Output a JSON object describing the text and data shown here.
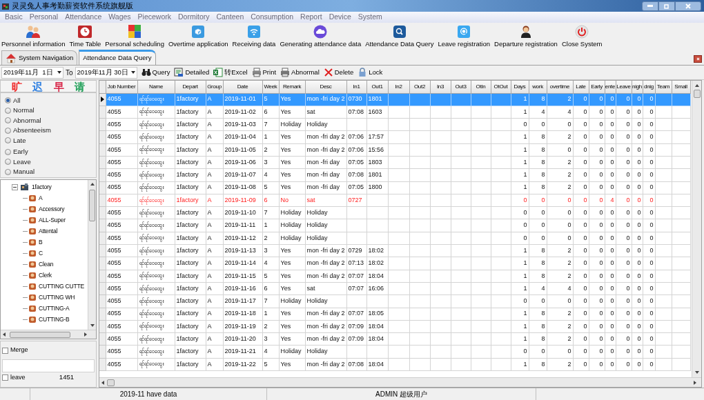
{
  "window": {
    "title": "灵灵兔人事考勤薪资软件系统旗舰版"
  },
  "menu": [
    "Basic",
    "Personal",
    "Attendance",
    "Wages",
    "Piecework",
    "Dormitory",
    "Canteen",
    "Consumption",
    "Report",
    "Device",
    "System"
  ],
  "toolbar": [
    {
      "label": "Personnel information"
    },
    {
      "label": "Time Table"
    },
    {
      "label": "Personal scheduling"
    },
    {
      "label": "Overtime application"
    },
    {
      "label": "Receiving data"
    },
    {
      "label": "Generating attendance data"
    },
    {
      "label": "Attendance Data Query"
    },
    {
      "label": "Leave registration"
    },
    {
      "label": "Departure registration"
    },
    {
      "label": "Close System"
    }
  ],
  "tabs": [
    {
      "label": "System Navigation",
      "selected": false
    },
    {
      "label": "Attendance Data Query",
      "selected": true
    }
  ],
  "query_bar": {
    "date_from": "2019年11月  1日",
    "to_label": "To",
    "date_to": "2019年11月 30日",
    "actions": [
      "Query",
      "Detailed",
      "转Excel",
      "Print",
      "Abnormal",
      "Delete",
      "Lock"
    ]
  },
  "legend": [
    {
      "label": "旷",
      "color": "#f02828"
    },
    {
      "label": "迟",
      "color": "#2a7de0"
    },
    {
      "label": "早",
      "color": "#d8284a"
    },
    {
      "label": "请",
      "color": "#20a058"
    }
  ],
  "filters": [
    {
      "label": "All",
      "selected": true
    },
    {
      "label": "Normal",
      "selected": false
    },
    {
      "label": "Abnormal",
      "selected": false
    },
    {
      "label": "Absenteeism",
      "selected": false
    },
    {
      "label": "Late",
      "selected": false
    },
    {
      "label": "Early",
      "selected": false
    },
    {
      "label": "Leave",
      "selected": false
    },
    {
      "label": "Manual",
      "selected": false
    }
  ],
  "tree": [
    {
      "label": "1factory",
      "expanded": true,
      "children": [
        {
          "label": "A"
        },
        {
          "label": "Accessory"
        },
        {
          "label": "ALL-Super"
        },
        {
          "label": "Attental"
        },
        {
          "label": "B"
        },
        {
          "label": "C"
        },
        {
          "label": "Clean"
        },
        {
          "label": "Clerk"
        },
        {
          "label": "CUTTING CUTTE"
        },
        {
          "label": "CUTTING WH"
        },
        {
          "label": "CUTTING-A"
        },
        {
          "label": "CUTTING-B"
        }
      ]
    }
  ],
  "merge": {
    "label": "Merge",
    "checked": false
  },
  "leave": {
    "label": "leave",
    "checked": false,
    "count": "1451"
  },
  "table": {
    "columns": [
      "Job Number",
      "Name",
      "Depart",
      "Group",
      "Date",
      "Week",
      "Remark",
      "Desc",
      "In1",
      "Out1",
      "In2",
      "Out2",
      "In3",
      "Out3",
      "OtIn",
      "OtOut",
      "Days",
      "work",
      "overtime",
      "Late",
      "Early",
      "ente",
      "Leave",
      "nigh",
      "dnig",
      "Team",
      "Small"
    ],
    "rows": [
      {
        "selected": true,
        "abnormal": false,
        "cells": [
          "4055",
          "ရင်ရင်ဝေထွေး",
          "1factory",
          "A",
          "2019-11-01",
          "5",
          "Yes",
          "mon -fri day 2",
          "0730",
          "1801",
          null,
          null,
          null,
          null,
          null,
          null,
          "1",
          "8",
          "2",
          "0",
          "0",
          "0",
          "0",
          "0",
          "0",
          null,
          null
        ]
      },
      {
        "selected": false,
        "abnormal": false,
        "cells": [
          "4055",
          "ရင်ရင်ဝေထွေး",
          "1factory",
          "A",
          "2019-11-02",
          "6",
          "Yes",
          "sat",
          "07:08",
          "1603",
          null,
          null,
          null,
          null,
          null,
          null,
          "1",
          "4",
          "4",
          "0",
          "0",
          "0",
          "0",
          "0",
          "0",
          null,
          null
        ]
      },
      {
        "selected": false,
        "abnormal": false,
        "cells": [
          "4055",
          "ရင်ရင်ဝေထွေး",
          "1factory",
          "A",
          "2019-11-03",
          "7",
          "Holiday",
          "Holiday",
          null,
          null,
          null,
          null,
          null,
          null,
          null,
          null,
          "0",
          "0",
          "0",
          "0",
          "0",
          "0",
          "0",
          "0",
          "0",
          null,
          null
        ]
      },
      {
        "selected": false,
        "abnormal": false,
        "cells": [
          "4055",
          "ရင်ရင်ဝေထွေး",
          "1factory",
          "A",
          "2019-11-04",
          "1",
          "Yes",
          "mon -fri day 2",
          "07:06",
          "17:57",
          null,
          null,
          null,
          null,
          null,
          null,
          "1",
          "8",
          "2",
          "0",
          "0",
          "0",
          "0",
          "0",
          "0",
          null,
          null
        ]
      },
      {
        "selected": false,
        "abnormal": false,
        "cells": [
          "4055",
          "ရင်ရင်ဝေထွေး",
          "1factory",
          "A",
          "2019-11-05",
          "2",
          "Yes",
          "mon -fri day 2",
          "07:06",
          "15:56",
          null,
          null,
          null,
          null,
          null,
          null,
          "1",
          "8",
          "0",
          "0",
          "0",
          "0",
          "0",
          "0",
          "0",
          null,
          null
        ]
      },
      {
        "selected": false,
        "abnormal": false,
        "cells": [
          "4055",
          "ရင်ရင်ဝေထွေး",
          "1factory",
          "A",
          "2019-11-06",
          "3",
          "Yes",
          "mon -fri day",
          "07:05",
          "1803",
          null,
          null,
          null,
          null,
          null,
          null,
          "1",
          "8",
          "2",
          "0",
          "0",
          "0",
          "0",
          "0",
          "0",
          null,
          null
        ]
      },
      {
        "selected": false,
        "abnormal": false,
        "cells": [
          "4055",
          "ရင်ရင်ဝေထွေး",
          "1factory",
          "A",
          "2019-11-07",
          "4",
          "Yes",
          "mon -fri day",
          "07:08",
          "1801",
          null,
          null,
          null,
          null,
          null,
          null,
          "1",
          "8",
          "2",
          "0",
          "0",
          "0",
          "0",
          "0",
          "0",
          null,
          null
        ]
      },
      {
        "selected": false,
        "abnormal": false,
        "cells": [
          "4055",
          "ရင်ရင်ဝေထွေး",
          "1factory",
          "A",
          "2019-11-08",
          "5",
          "Yes",
          "mon -fri day",
          "07:05",
          "1800",
          null,
          null,
          null,
          null,
          null,
          null,
          "1",
          "8",
          "2",
          "0",
          "0",
          "0",
          "0",
          "0",
          "0",
          null,
          null
        ]
      },
      {
        "selected": false,
        "abnormal": true,
        "cells": [
          "4055",
          "ရင်ရင်ဝေထွေး",
          "1factory",
          "A",
          "2019-11-09",
          "6",
          "No",
          "sat",
          "0727",
          null,
          null,
          null,
          null,
          null,
          null,
          null,
          "0",
          "0",
          "0",
          "0",
          "0",
          "4",
          "0",
          "0",
          "0",
          null,
          null
        ]
      },
      {
        "selected": false,
        "abnormal": false,
        "cells": [
          "4055",
          "ရင်ရင်ဝေထွေး",
          "1factory",
          "A",
          "2019-11-10",
          "7",
          "Holiday",
          "Holiday",
          null,
          null,
          null,
          null,
          null,
          null,
          null,
          null,
          "0",
          "0",
          "0",
          "0",
          "0",
          "0",
          "0",
          "0",
          "0",
          null,
          null
        ]
      },
      {
        "selected": false,
        "abnormal": false,
        "cells": [
          "4055",
          "ရင်ရင်ဝေထွေး",
          "1factory",
          "A",
          "2019-11-11",
          "1",
          "Holiday",
          "Holiday",
          null,
          null,
          null,
          null,
          null,
          null,
          null,
          null,
          "0",
          "0",
          "0",
          "0",
          "0",
          "0",
          "0",
          "0",
          "0",
          null,
          null
        ]
      },
      {
        "selected": false,
        "abnormal": false,
        "cells": [
          "4055",
          "ရင်ရင်ဝေထွေး",
          "1factory",
          "A",
          "2019-11-12",
          "2",
          "Holiday",
          "Holiday",
          null,
          null,
          null,
          null,
          null,
          null,
          null,
          null,
          "0",
          "0",
          "0",
          "0",
          "0",
          "0",
          "0",
          "0",
          "0",
          null,
          null
        ]
      },
      {
        "selected": false,
        "abnormal": false,
        "cells": [
          "4055",
          "ရင်ရင်ဝေထွေး",
          "1factory",
          "A",
          "2019-11-13",
          "3",
          "Yes",
          "mon -fri day 2",
          "0729",
          "18:02",
          null,
          null,
          null,
          null,
          null,
          null,
          "1",
          "8",
          "2",
          "0",
          "0",
          "0",
          "0",
          "0",
          "0",
          null,
          null
        ]
      },
      {
        "selected": false,
        "abnormal": false,
        "cells": [
          "4055",
          "ရင်ရင်ဝေထွေး",
          "1factory",
          "A",
          "2019-11-14",
          "4",
          "Yes",
          "mon -fri day 2",
          "07:13",
          "18:02",
          null,
          null,
          null,
          null,
          null,
          null,
          "1",
          "8",
          "2",
          "0",
          "0",
          "0",
          "0",
          "0",
          "0",
          null,
          null
        ]
      },
      {
        "selected": false,
        "abnormal": false,
        "cells": [
          "4055",
          "ရင်ရင်ဝေထွေး",
          "1factory",
          "A",
          "2019-11-15",
          "5",
          "Yes",
          "mon -fri day 2",
          "07:07",
          "18:04",
          null,
          null,
          null,
          null,
          null,
          null,
          "1",
          "8",
          "2",
          "0",
          "0",
          "0",
          "0",
          "0",
          "0",
          null,
          null
        ]
      },
      {
        "selected": false,
        "abnormal": false,
        "cells": [
          "4055",
          "ရင်ရင်ဝေထွေး",
          "1factory",
          "A",
          "2019-11-16",
          "6",
          "Yes",
          "sat",
          "07:07",
          "16:06",
          null,
          null,
          null,
          null,
          null,
          null,
          "1",
          "4",
          "4",
          "0",
          "0",
          "0",
          "0",
          "0",
          "0",
          null,
          null
        ]
      },
      {
        "selected": false,
        "abnormal": false,
        "cells": [
          "4055",
          "ရင်ရင်ဝေထွေး",
          "1factory",
          "A",
          "2019-11-17",
          "7",
          "Holiday",
          "Holiday",
          null,
          null,
          null,
          null,
          null,
          null,
          null,
          null,
          "0",
          "0",
          "0",
          "0",
          "0",
          "0",
          "0",
          "0",
          "0",
          null,
          null
        ]
      },
      {
        "selected": false,
        "abnormal": false,
        "cells": [
          "4055",
          "ရင်ရင်ဝေထွေး",
          "1factory",
          "A",
          "2019-11-18",
          "1",
          "Yes",
          "mon -fri day 2",
          "07:07",
          "18:05",
          null,
          null,
          null,
          null,
          null,
          null,
          "1",
          "8",
          "2",
          "0",
          "0",
          "0",
          "0",
          "0",
          "0",
          null,
          null
        ]
      },
      {
        "selected": false,
        "abnormal": false,
        "cells": [
          "4055",
          "ရင်ရင်ဝေထွေး",
          "1factory",
          "A",
          "2019-11-19",
          "2",
          "Yes",
          "mon -fri day 2",
          "07:09",
          "18:04",
          null,
          null,
          null,
          null,
          null,
          null,
          "1",
          "8",
          "2",
          "0",
          "0",
          "0",
          "0",
          "0",
          "0",
          null,
          null
        ]
      },
      {
        "selected": false,
        "abnormal": false,
        "cells": [
          "4055",
          "ရင်ရင်ဝေထွေး",
          "1factory",
          "A",
          "2019-11-20",
          "3",
          "Yes",
          "mon -fri day 2",
          "07:09",
          "18:04",
          null,
          null,
          null,
          null,
          null,
          null,
          "1",
          "8",
          "2",
          "0",
          "0",
          "0",
          "0",
          "0",
          "0",
          null,
          null
        ]
      },
      {
        "selected": false,
        "abnormal": false,
        "cells": [
          "4055",
          "ရင်ရင်ဝေထွေး",
          "1factory",
          "A",
          "2019-11-21",
          "4",
          "Holiday",
          "Holiday",
          null,
          null,
          null,
          null,
          null,
          null,
          null,
          null,
          "0",
          "0",
          "0",
          "0",
          "0",
          "0",
          "0",
          "0",
          "0",
          null,
          null
        ]
      },
      {
        "selected": false,
        "abnormal": false,
        "cells": [
          "4055",
          "ရင်ရင်ဝေထွေး",
          "1factory",
          "A",
          "2019-11-22",
          "5",
          "Yes",
          "mon -fri day 2",
          "07:08",
          "18:04",
          null,
          null,
          null,
          null,
          null,
          null,
          "1",
          "8",
          "2",
          "0",
          "0",
          "0",
          "0",
          "0",
          "0",
          null,
          null
        ]
      }
    ]
  },
  "status_bar": [
    "2019-11 have data",
    "ADMIN 超级用户"
  ]
}
